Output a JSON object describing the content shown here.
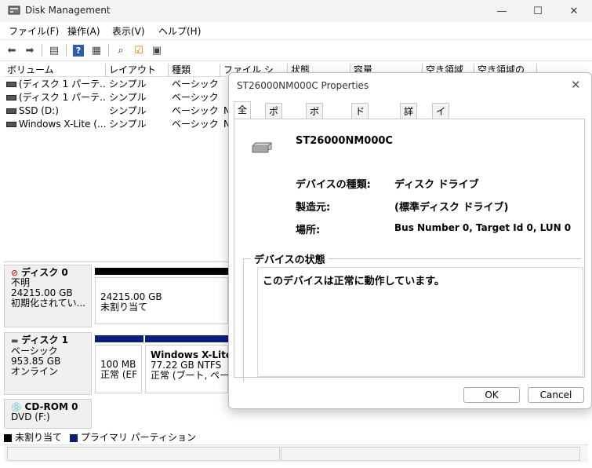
{
  "window": {
    "title": "Disk Management",
    "minimize_icon": "minimize-icon",
    "maximize_icon": "maximize-icon",
    "close_icon": "close-icon"
  },
  "menu": [
    "ファイル(F)",
    "操作(A)",
    "表示(V)",
    "ヘルプ(H)"
  ],
  "volume_list": {
    "headers": [
      "ボリューム",
      "レイアウト",
      "種類",
      "ファイル シ",
      "状態",
      "容量",
      "空き領域",
      "空き領域の"
    ],
    "rows": [
      {
        "name": "(ディスク 1 パーテ...",
        "layout": "シンプル",
        "type": "ベーシック",
        "fs": ""
      },
      {
        "name": "(ディスク 1 パーテ...",
        "layout": "シンプル",
        "type": "ベーシック",
        "fs": ""
      },
      {
        "name": "SSD (D:)",
        "layout": "シンプル",
        "type": "ベーシック",
        "fs": "N"
      },
      {
        "name": "Windows X-Lite (...",
        "layout": "シンプル",
        "type": "ベーシック",
        "fs": "N"
      }
    ]
  },
  "disks": [
    {
      "name": "ディスク 0",
      "line1": "不明",
      "line2": "24215.00 GB",
      "line3": "初期化されてい...",
      "partitions": [
        {
          "size": "24215.00 GB",
          "status": "未割り当て"
        }
      ]
    },
    {
      "name": "ディスク 1",
      "line1": "ベーシック",
      "line2": "953.85 GB",
      "line3": "オンライン",
      "partitions": [
        {
          "size": "100 MB",
          "status": "正常 (EF"
        },
        {
          "title": "Windows X-Lite",
          "size": "77.22 GB NTFS",
          "status": "正常 (ブート, ページ"
        }
      ]
    },
    {
      "name": "CD-ROM 0",
      "line1": "DVD (F:)"
    }
  ],
  "legend": {
    "unallocated": "未割り当て",
    "primary": "プライマリ パーティション"
  },
  "colors": {
    "unallocated": "#000000",
    "primary": "#0b1f7a"
  },
  "dialog": {
    "title": "ST26000NM000C Properties",
    "tabs": [
      "全般",
      "ポリシー",
      "ボリューム",
      "ドライバー",
      "詳細",
      "イベント"
    ],
    "device_name": "ST26000NM000C",
    "props": [
      {
        "label": "デバイスの種類:",
        "value": "ディスク ドライブ"
      },
      {
        "label": "製造元:",
        "value": "(標準ディスク ドライブ)"
      },
      {
        "label": "場所:",
        "value": "Bus Number 0, Target Id 0, LUN 0"
      }
    ],
    "status_group": "デバイスの状態",
    "status_text": "このデバイスは正常に動作しています。",
    "ok": "OK",
    "cancel": "Cancel"
  }
}
